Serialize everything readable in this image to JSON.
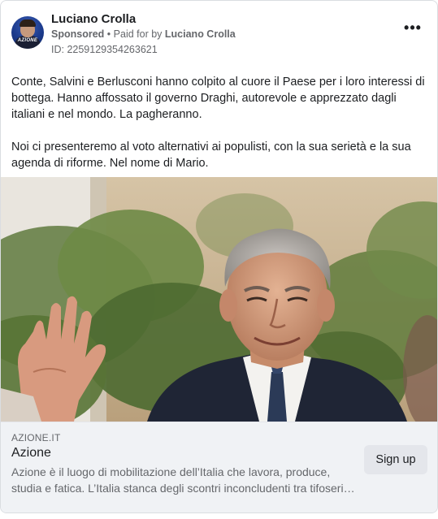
{
  "post": {
    "page_name": "Luciano Crolla",
    "avatar_brand": "AZIONE",
    "sponsored": "Sponsored",
    "separator": "•",
    "paid_for_by_prefix": "Paid for by",
    "paid_for_by": "Luciano Crolla",
    "ad_id": "ID: 2259129354263621",
    "more_icon": "more-horizontal-icon",
    "more_label": "•••",
    "paragraphs": [
      "Conte, Salvini e Berlusconi hanno colpito al cuore il Paese per i loro interessi di bottega. Hanno affossato il governo Draghi, autorevole e apprezzato dagli italiani e nel mondo. La pagheranno.",
      "Noi ci presenteremo al voto alternativi ai populisti, con la sua serietà e la sua agenda di riforme. Nel nome di Mario."
    ]
  },
  "link_preview": {
    "domain": "AZIONE.IT",
    "title": "Azione",
    "description_line1": "Azione è il luogo di mobilitazione dell’Italia che lavora, produce,",
    "description_line2": "studia e fatica. L’Italia stanca degli scontri inconcludenti tra tifoserie…",
    "cta_label": "Sign up"
  },
  "colors": {
    "brand_avatar": "#1b3a8c",
    "text_primary": "#1c1e21",
    "text_secondary": "#65676b",
    "footer_bg": "#f0f2f5",
    "button_bg": "#e4e6eb"
  }
}
